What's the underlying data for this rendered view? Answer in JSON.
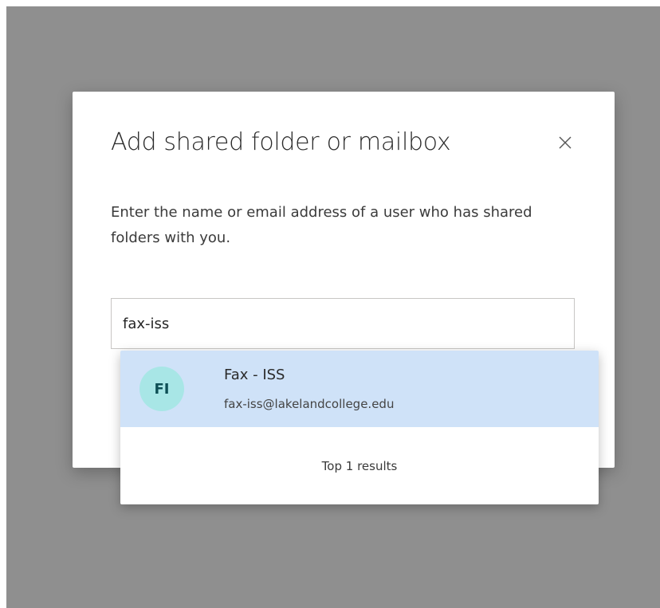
{
  "dialog": {
    "title": "Add shared folder or mailbox",
    "close_icon": "close-icon",
    "description": "Enter the name or email address of a user who has shared folders with you."
  },
  "search": {
    "value": "fax-iss"
  },
  "suggestions": {
    "items": [
      {
        "initials": "FI",
        "name": "Fax - ISS",
        "email": "fax-iss@lakelandcollege.edu",
        "avatar_color": "#a8e6e6",
        "highlight_color": "#cfe2f8"
      }
    ],
    "footer": "Top 1 results"
  }
}
